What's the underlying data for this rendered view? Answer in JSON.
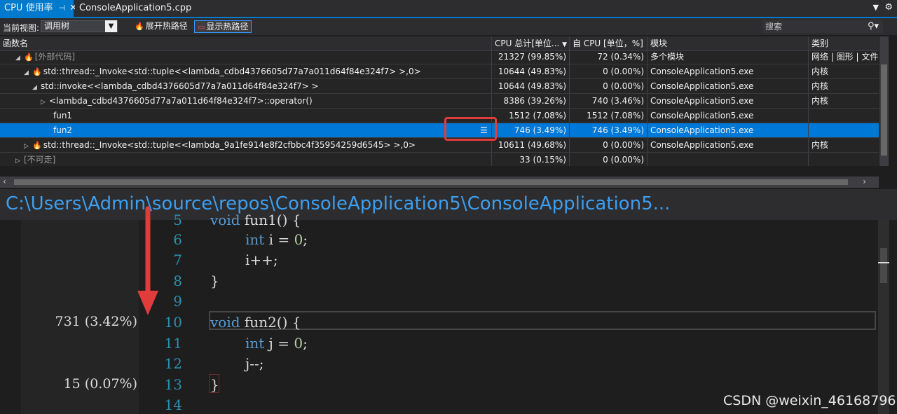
{
  "tabs": [
    {
      "label": "CPU 使用率",
      "pin": "⊣",
      "close": "✕"
    },
    {
      "label": "ConsoleApplication5.cpp"
    }
  ],
  "toolbar": {
    "view_label": "当前视图:",
    "view_value": "调用树",
    "expand_label": "展开热路径",
    "show_label": "显示热路径",
    "search_placeholder": "搜索"
  },
  "grid": {
    "headers": {
      "name": "函数名",
      "total": "CPU 总计[单位...",
      "self": "自 CPU [单位，%]",
      "module": "模块",
      "category": "类别"
    },
    "rows": [
      {
        "name": "[外部代码]",
        "total": "21327 (99.85%)",
        "self": "72 (0.34%)",
        "module": "多个模块",
        "category": "网络 | 图形 | 文件..."
      },
      {
        "name": "std::thread::_Invoke<std::tuple<<lambda_cdbd4376605d77a7a011d64f84e324f7> >,0>",
        "total": "10644 (49.83%)",
        "self": "0 (0.00%)",
        "module": "ConsoleApplication5.exe",
        "category": "内核"
      },
      {
        "name": "std::invoke<<lambda_cdbd4376605d77a7a011d64f84e324f7> >",
        "total": "10644 (49.83%)",
        "self": "0 (0.00%)",
        "module": "ConsoleApplication5.exe",
        "category": "内核"
      },
      {
        "name": "<lambda_cdbd4376605d77a7a011d64f84e324f7>::operator()",
        "total": "8386 (39.26%)",
        "self": "740 (3.46%)",
        "module": "ConsoleApplication5.exe",
        "category": "内核"
      },
      {
        "name": "fun1",
        "total": "1512 (7.08%)",
        "self": "1512 (7.08%)",
        "module": "ConsoleApplication5.exe",
        "category": ""
      },
      {
        "name": "fun2",
        "total": "746 (3.49%)",
        "self": "746 (3.49%)",
        "module": "ConsoleApplication5.exe",
        "category": ""
      },
      {
        "name": "std::thread::_Invoke<std::tuple<<lambda_9a1fe914e8f2cfbbc4f35954259d6545> >,0>",
        "total": "10611 (49.68%)",
        "self": "0 (0.00%)",
        "module": "ConsoleApplication5.exe",
        "category": "内核"
      },
      {
        "name": "[不可走]",
        "total": "33 (0.15%)",
        "self": "0 (0.00%)",
        "module": "",
        "category": ""
      }
    ]
  },
  "path": "C:\\Users\\Admin\\source\\repos\\ConsoleApplication5\\ConsoleApplication5...",
  "code": {
    "perf": [
      "731 (3.42%)",
      "15 (0.07%)"
    ],
    "line_numbers": [
      "5",
      "6",
      "7",
      "8",
      "9",
      "10",
      "11",
      "12",
      "13",
      "14"
    ],
    "tokens": {
      "void": "void",
      "int": "int",
      "fun1_sig": " fun1() {",
      "fun2_sig": " fun2() {",
      "i_decl": " i = ",
      "j_decl": " j = ",
      "zero": "0",
      "semi": ";",
      "i_inc": "i++;",
      "j_dec": "j--;",
      "close_brace": "}"
    }
  },
  "watermark": "CSDN @weixin_46168796",
  "colors": {
    "accent": "#007acc",
    "selected": "#0078d7",
    "hotpath_box": "#e03c3c",
    "keyword": "#569cd6",
    "number": "#b5cea8",
    "line_number": "#2b91af"
  }
}
